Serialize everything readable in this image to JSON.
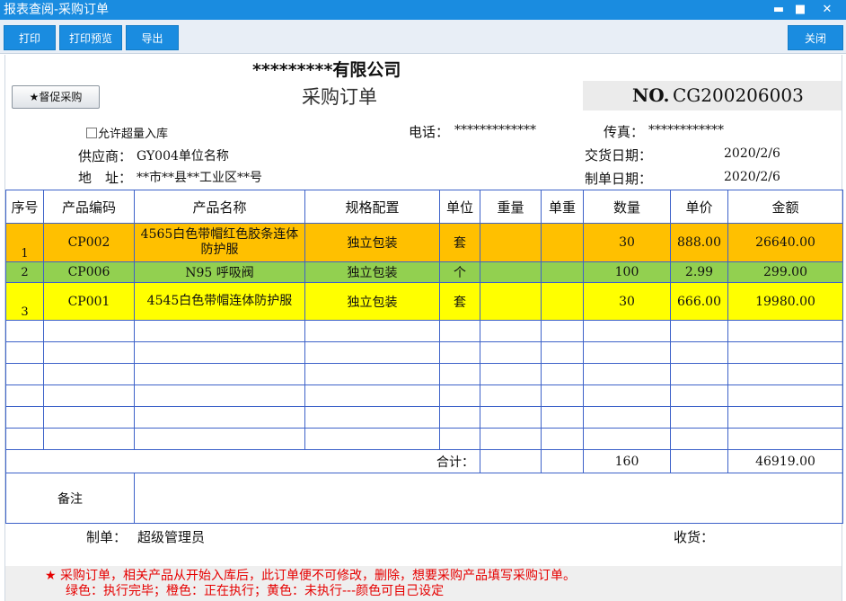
{
  "window": {
    "title": "报表查阅-采购订单",
    "minimize": "▬",
    "maximize": "■",
    "close": "✕"
  },
  "toolbar": {
    "print": "打印",
    "print_preview": "打印预览",
    "export": "导出",
    "close": "关闭"
  },
  "header": {
    "company": "*********有限公司",
    "title": "采购订单",
    "urge_button": "★督促采购",
    "no_label": "NO.",
    "no_value": "CG200206003",
    "allow_over": "允许超量入库",
    "phone_label": "电话：",
    "phone_value": "*************",
    "fax_label": "传真：",
    "fax_value": "************",
    "supplier_label": "供应商：",
    "supplier_value": "GY004单位名称",
    "delivery_label": "交货日期：",
    "delivery_value": "2020/2/6",
    "address_label": "地　址：",
    "address_value": "**市**县**工业区**号",
    "created_label": "制单日期：",
    "created_value": "2020/2/6"
  },
  "table": {
    "columns": [
      "序号",
      "产品编码",
      "产品名称",
      "规格配置",
      "单位",
      "重量",
      "单重",
      "数量",
      "单价",
      "金额"
    ],
    "rows": [
      {
        "seq": "1",
        "code": "CP002",
        "name": "4565白色带帽红色胶条连体防护服",
        "spec": "独立包装",
        "unit": "套",
        "weight": "",
        "unit_weight": "",
        "qty": "30",
        "price": "888.00",
        "amount": "26640.00",
        "status_color": "#ffc000"
      },
      {
        "seq": "2",
        "code": "CP006",
        "name": "N95 呼吸阀",
        "spec": "独立包装",
        "unit": "个",
        "weight": "",
        "unit_weight": "",
        "qty": "100",
        "price": "2.99",
        "amount": "299.00",
        "status_color": "#92d050"
      },
      {
        "seq": "3",
        "code": "CP001",
        "name": "4545白色带帽连体防护服",
        "spec": "独立包装",
        "unit": "套",
        "weight": "",
        "unit_weight": "",
        "qty": "30",
        "price": "666.00",
        "amount": "19980.00",
        "status_color": "#ffff00"
      }
    ],
    "total_label": "合计：",
    "total_qty": "160",
    "total_amount": "46919.00",
    "remark_label": "备注",
    "remark_value": ""
  },
  "footer": {
    "creator_label": "制单：",
    "creator_value": "超级管理员",
    "receiver_label": "收货：",
    "receiver_value": ""
  },
  "notes": {
    "star": "★",
    "line1": "采购订单，相关产品从开始入库后，此订单便不可修改，删除，想要采购产品填写采购订单。",
    "line2": "绿色：执行完毕；橙色：正在执行；黄色：未执行---颜色可自己设定"
  },
  "colors": {
    "titlebar": "#1a8ce0",
    "executing": "#ffc000",
    "completed": "#92d050",
    "pending": "#ffff00",
    "grid_line": "#3d62c9",
    "note_text": "#e60000"
  }
}
